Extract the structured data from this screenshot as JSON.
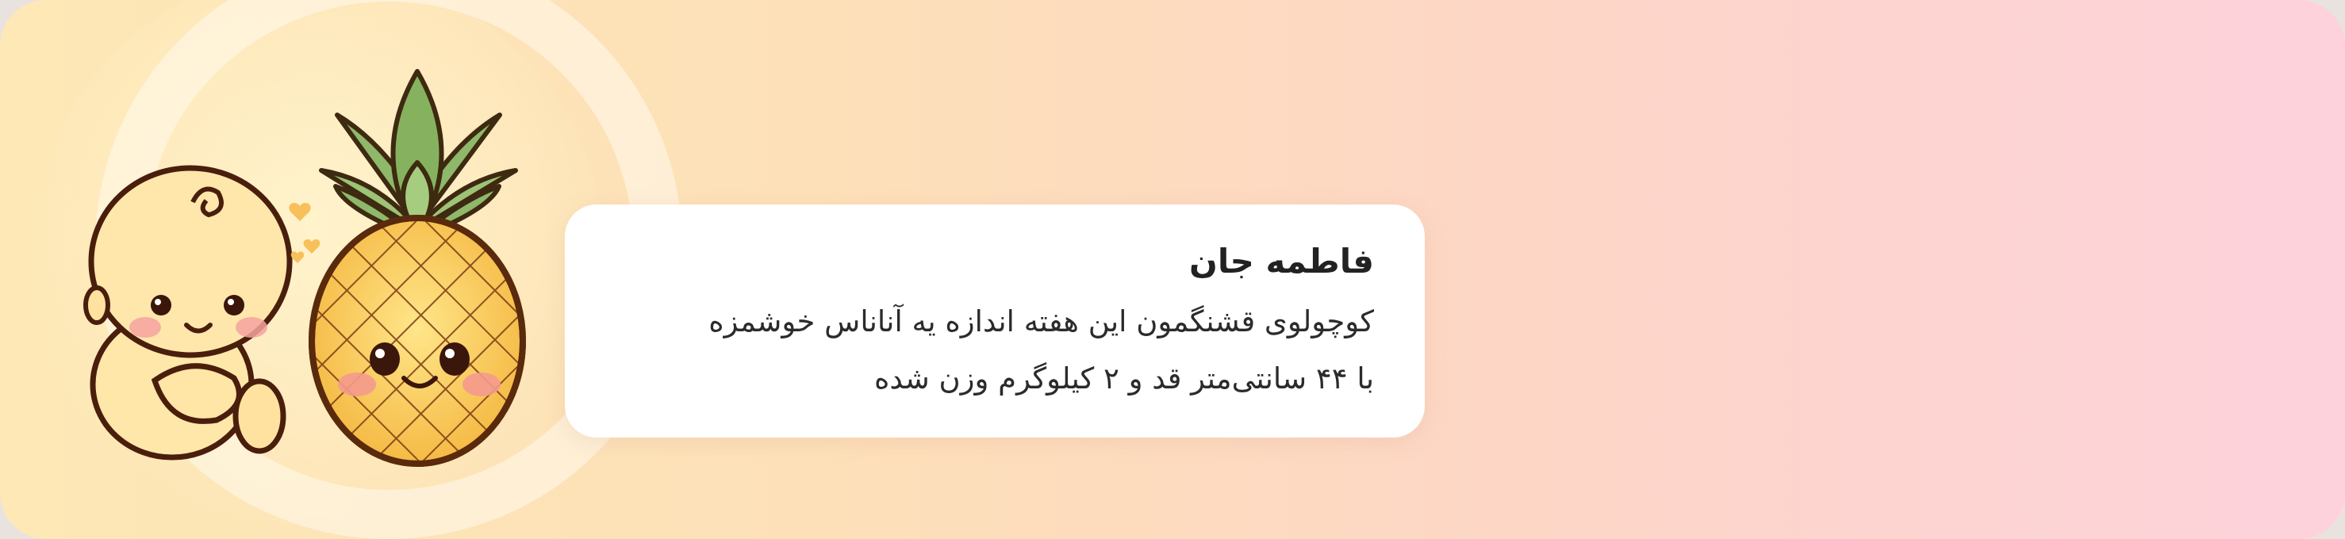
{
  "message": {
    "title": "فاطمه جان",
    "line1": "کوچولوی قشنگمون این هفته اندازه یه آناناس خوشمزه",
    "line2": "با ۴۴ سانتی‌متر قد و ۲ کیلوگرم وزن شده"
  },
  "illustration": {
    "baby": "baby-illustration",
    "fruit": "pineapple-illustration",
    "hearts": "hearts-icon"
  },
  "colors": {
    "background_start": "#fde8b6",
    "background_end": "#fdd2dc",
    "card": "#ffffff",
    "text": "#222222"
  }
}
